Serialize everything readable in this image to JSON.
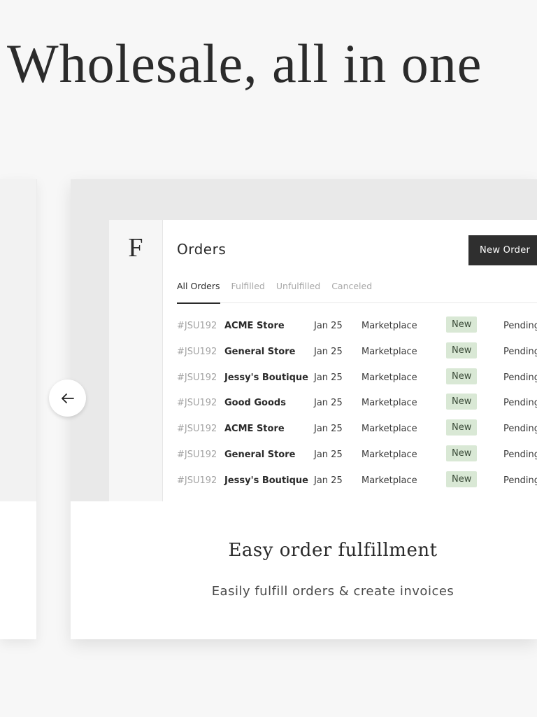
{
  "hero": {
    "title": "Wholesale, all in one"
  },
  "slide": {
    "app": {
      "logo": "F",
      "title": "Orders",
      "new_order_label": "New Order",
      "tabs": [
        {
          "label": "All Orders",
          "active": true
        },
        {
          "label": "Fulfilled",
          "active": false
        },
        {
          "label": "Unfulfilled",
          "active": false
        },
        {
          "label": "Canceled",
          "active": false
        }
      ],
      "orders": [
        {
          "id": "#JSU192",
          "store": "ACME Store",
          "date": "Jan 25",
          "channel": "Marketplace",
          "badge": "New",
          "status": "Pending"
        },
        {
          "id": "#JSU192",
          "store": "General Store",
          "date": "Jan 25",
          "channel": "Marketplace",
          "badge": "New",
          "status": "Pending"
        },
        {
          "id": "#JSU192",
          "store": "Jessy's Boutique",
          "date": "Jan 25",
          "channel": "Marketplace",
          "badge": "New",
          "status": "Pending"
        },
        {
          "id": "#JSU192",
          "store": "Good Goods",
          "date": "Jan 25",
          "channel": "Marketplace",
          "badge": "New",
          "status": "Pending"
        },
        {
          "id": "#JSU192",
          "store": "ACME Store",
          "date": "Jan 25",
          "channel": "Marketplace",
          "badge": "New",
          "status": "Pending"
        },
        {
          "id": "#JSU192",
          "store": "General Store",
          "date": "Jan 25",
          "channel": "Marketplace",
          "badge": "New",
          "status": "Pending"
        },
        {
          "id": "#JSU192",
          "store": "Jessy's Boutique",
          "date": "Jan 25",
          "channel": "Marketplace",
          "badge": "New",
          "status": "Pending"
        }
      ]
    },
    "caption": {
      "title": "Easy order fulfillment",
      "subtitle": "Easily fulfill orders & create invoices"
    }
  },
  "carousel": {
    "prev_icon": "arrow-left-icon"
  },
  "colors": {
    "page_background": "#f7f7f7",
    "button_dark": "#2f2f2f",
    "badge_green": "#d9e8d5"
  }
}
